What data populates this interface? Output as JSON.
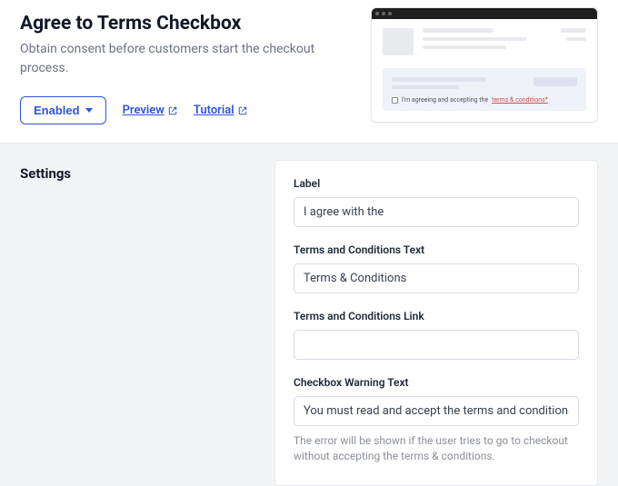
{
  "header": {
    "title": "Agree to Terms Checkbox",
    "subtitle": "Obtain consent before customers start the checkout process.",
    "enabled_label": "Enabled",
    "links": {
      "preview": "Preview",
      "tutorial": "Tutorial"
    },
    "mock": {
      "consent_prefix": "I'm agreeing and accepting the",
      "consent_terms": "terms & conditions*"
    }
  },
  "settings": {
    "title": "Settings",
    "fields": {
      "label": {
        "label": "Label",
        "value": "I agree with the"
      },
      "terms_text": {
        "label": "Terms and Conditions Text",
        "value": "Terms & Conditions"
      },
      "terms_link": {
        "label": "Terms and Conditions Link",
        "value": ""
      },
      "warning": {
        "label": "Checkbox Warning Text",
        "value": "You must read and accept the terms and conditions to complete checkout",
        "help": "The error will be shown if the user tries to go to checkout without accepting the terms & conditions."
      }
    }
  }
}
